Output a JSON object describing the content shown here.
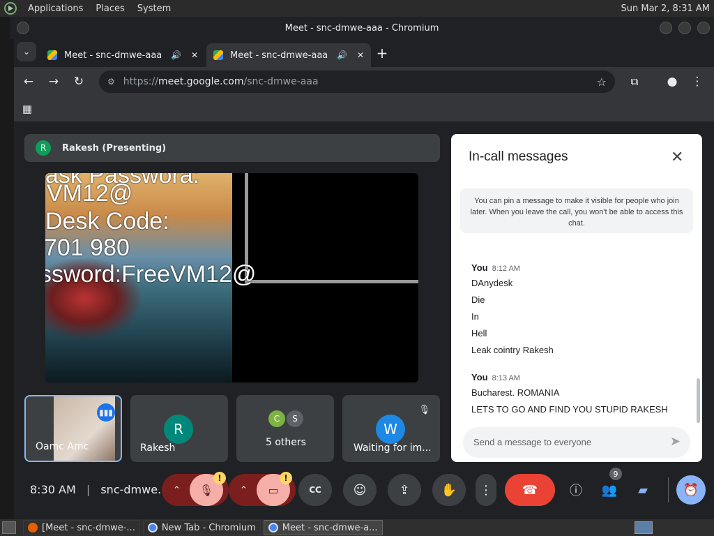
{
  "system_panel": {
    "menus": [
      "Applications",
      "Places",
      "System"
    ],
    "datetime": "Sun Mar 2, 8:31 AM"
  },
  "window": {
    "title": "Meet - snc-dmwe-aaa - Chromium"
  },
  "tabs": [
    {
      "title": "Meet - snc-dmwe-aaa",
      "active": false
    },
    {
      "title": "Meet - snc-dmwe-aaa",
      "active": true
    }
  ],
  "omnibox": {
    "scheme": "https://",
    "host": "meet.google.com",
    "path": "/snc-dmwe-aaa"
  },
  "presenter": {
    "initial": "R",
    "label": "Rakesh (Presenting)"
  },
  "shared_screen": {
    "lines": [
      "ask Passwora:",
      "VM12@",
      " Desk Code:",
      "701 980",
      "ssword:FreeVM12@"
    ]
  },
  "tiles": [
    {
      "name": "Oamc Amc"
    },
    {
      "name": "Rakesh",
      "initial": "R",
      "color": "#00897b"
    },
    {
      "name": "5 others",
      "initials": [
        "C",
        "S"
      ]
    },
    {
      "name": "Waiting for im...",
      "initial": "W",
      "color": "#1e88e5"
    }
  ],
  "chat": {
    "title": "In-call messages",
    "pin_note": "You can pin a message to make it visible for people who join later. When you leave the call, you won't be able to access this chat.",
    "groups": [
      {
        "sender": "You",
        "time": "8:12 AM",
        "lines": [
          "DAnydesk",
          "Die",
          "In",
          "Hell",
          "Leak cointry Rakesh"
        ]
      },
      {
        "sender": "You",
        "time": "8:13 AM",
        "lines": [
          "Bucharest. ROMANIA",
          "LETS TO GO AND FIND YOU STUPID RAKESH"
        ]
      }
    ],
    "input_placeholder": "Send a message to everyone"
  },
  "controls": {
    "time": "8:30 AM",
    "meeting_code": "snc-dmwe...",
    "people_count": "9",
    "warning": "!"
  },
  "taskbar": {
    "items": [
      "[Meet - snc-dmwe-...",
      "New Tab - Chromium",
      "Meet - snc-dmwe-a..."
    ]
  }
}
